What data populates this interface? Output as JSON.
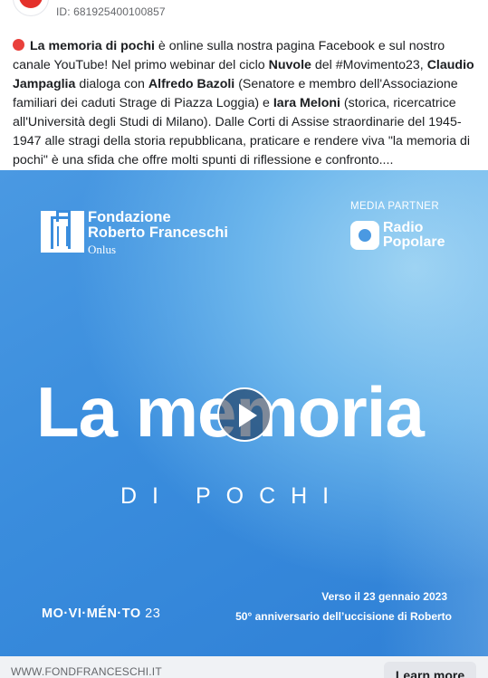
{
  "post": {
    "id_label": "ID: 681925400100857",
    "text": {
      "s1": "La memoria di pochi",
      "s2": " è online sulla nostra pagina Facebook e sul nostro canale YouTube! Nel primo webinar del ciclo ",
      "s3": "Nuvole",
      "s4": " del #Movimento23, ",
      "s5": "Claudio Jampaglia",
      "s6": " dialoga con ",
      "s7": "Alfredo Bazoli",
      "s8": " (Senatore e membro dell'Associazione familiari dei caduti Strage di Piazza Loggia) e ",
      "s9": "Iara Meloni",
      "s10": " (storica, ricercatrice all'Università degli Studi di Milano). Dalle Corti di Assise straordinarie del 1945-1947 alle stragi della storia repubblicana, praticare e rendere viva \"la memoria di pochi\" è una sfida che offre molti spunti di riflessione e confronto...."
    }
  },
  "media": {
    "org_name_line1": "Fondazione",
    "org_name_line2": "Roberto Franceschi",
    "org_suffix": "Onlus",
    "partner_label": "MEDIA PARTNER",
    "partner_name_line1": "Radio",
    "partner_name_line2": "Popolare",
    "title": "La memoria",
    "subtitle": "DI POCHI",
    "movimento_text": "MO·VI·MÉN·TO",
    "movimento_num": "23",
    "date_line": "Verso il 23 gennaio 2023",
    "anniversary_line": "50° anniversario dell’uccisione di Roberto"
  },
  "link": {
    "domain": "WWW.FONDFRANCESCHI.IT",
    "cta": "Learn more"
  },
  "colors": {
    "accent_blue": "#3a8ddd",
    "red_dot": "#e9403b"
  },
  "icons": {
    "play": "play-icon",
    "dot": "red-circle-icon"
  }
}
